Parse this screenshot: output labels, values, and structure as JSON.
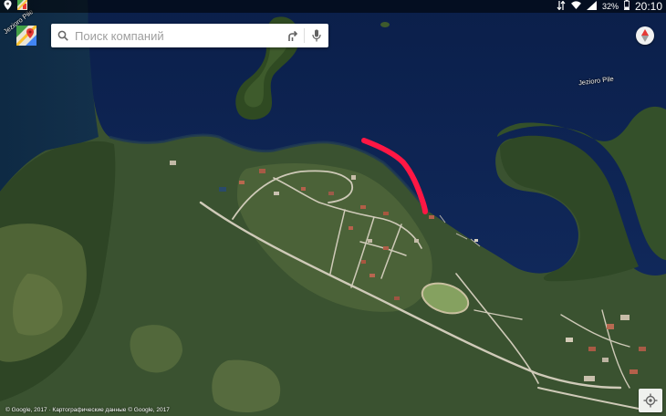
{
  "status_bar": {
    "battery_percent": "32%",
    "time": "20:10"
  },
  "search": {
    "placeholder": "Поиск компаний"
  },
  "map": {
    "lake_label": "Jezioro Pile",
    "west_lake_label": "Jezioro Pile",
    "attribution": "© Google, 2017 · Картографические данные © Google, 2017",
    "highlight_color": "#ff1744"
  },
  "icons": {
    "location": "location-icon",
    "maps_app": "google-maps-icon",
    "search": "search-icon",
    "directions": "directions-icon",
    "voice": "mic-icon",
    "compass": "compass-icon",
    "my_location": "my-location-icon"
  }
}
